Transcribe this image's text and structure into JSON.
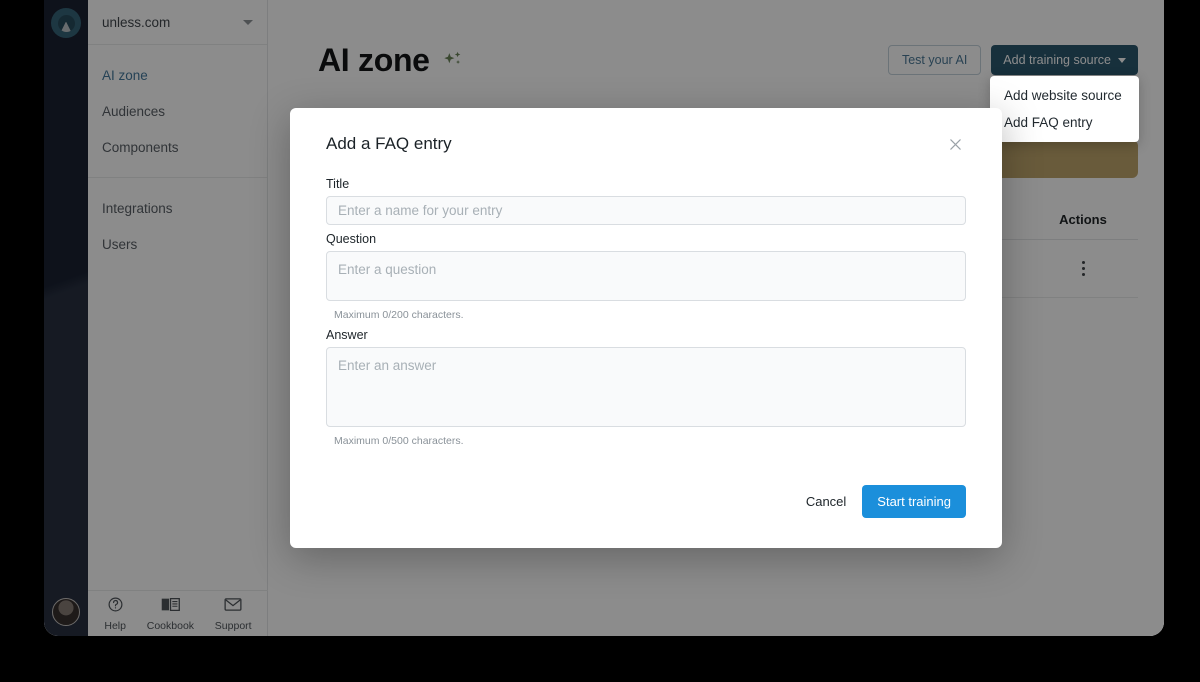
{
  "rail": {
    "logo_icon": "unless-logo-icon",
    "avatar_icon": "user-avatar"
  },
  "sidebar": {
    "workspace": "unless.com",
    "workspace_caret_icon": "chevron-down-icon",
    "groups": [
      {
        "items": [
          {
            "label": "AI zone",
            "active": true
          },
          {
            "label": "Audiences",
            "active": false
          },
          {
            "label": "Components",
            "active": false
          }
        ]
      },
      {
        "items": [
          {
            "label": "Integrations",
            "active": false
          },
          {
            "label": "Users",
            "active": false
          }
        ]
      }
    ],
    "bottom": [
      {
        "label": "Help",
        "icon": "question-circle-icon"
      },
      {
        "label": "Cookbook",
        "icon": "book-icon"
      },
      {
        "label": "Support",
        "icon": "envelope-icon"
      }
    ]
  },
  "header": {
    "title": "AI zone",
    "sparkle_icon": "sparkle-icon",
    "sparkle_color": "#5b8a3c",
    "test_button": "Test your AI",
    "add_source_button": "Add training source",
    "add_source_caret_icon": "chevron-down-icon"
  },
  "dropdown": {
    "open": true,
    "items": [
      "Add website source",
      "Add FAQ entry"
    ]
  },
  "toolbar": {
    "refresh_icon": "refresh-icon",
    "view_icon": "list-view-icon",
    "view_caret_icon": "caret-down-icon"
  },
  "banner": {
    "color": "#d4a43c"
  },
  "table": {
    "columns": [
      "Actions"
    ],
    "rows": [
      {
        "actions_icon": "kebab-menu-icon"
      }
    ]
  },
  "modal": {
    "title": "Add a FAQ entry",
    "close_icon": "close-icon",
    "fields": {
      "title": {
        "label": "Title",
        "placeholder": "Enter a name for your entry",
        "value": ""
      },
      "question": {
        "label": "Question",
        "placeholder": "Enter a question",
        "value": "",
        "helper": "Maximum 0/200 characters."
      },
      "answer": {
        "label": "Answer",
        "placeholder": "Enter an answer",
        "value": "",
        "helper": "Maximum 0/500 characters."
      }
    },
    "cancel_label": "Cancel",
    "submit_label": "Start training",
    "submit_color": "#1b8fdb"
  }
}
